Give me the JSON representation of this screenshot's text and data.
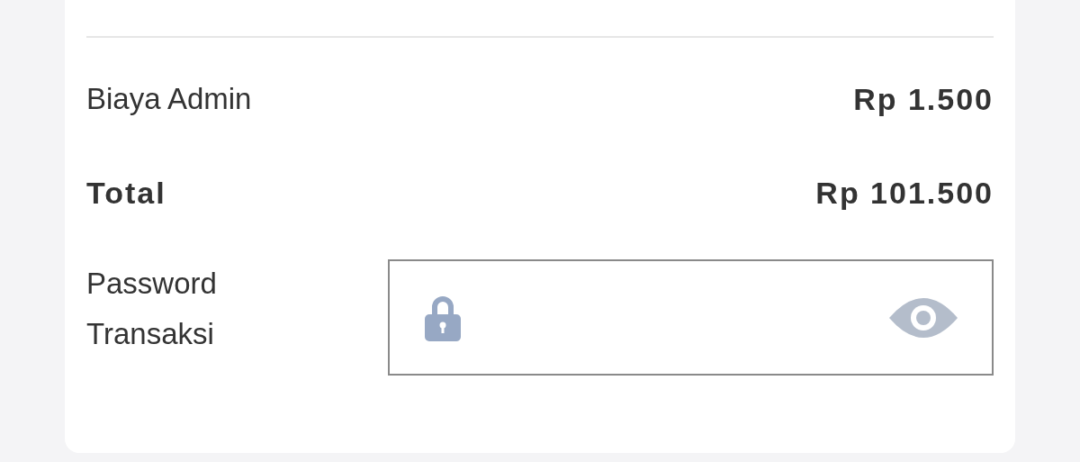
{
  "summary": {
    "rows": [
      {
        "kind": "normal",
        "label": "Biaya Admin",
        "value": "Rp 1.500"
      },
      {
        "kind": "total",
        "label": "Total",
        "value": "Rp 101.500"
      }
    ]
  },
  "password": {
    "label_lines": [
      "Password",
      "Transaksi"
    ]
  }
}
